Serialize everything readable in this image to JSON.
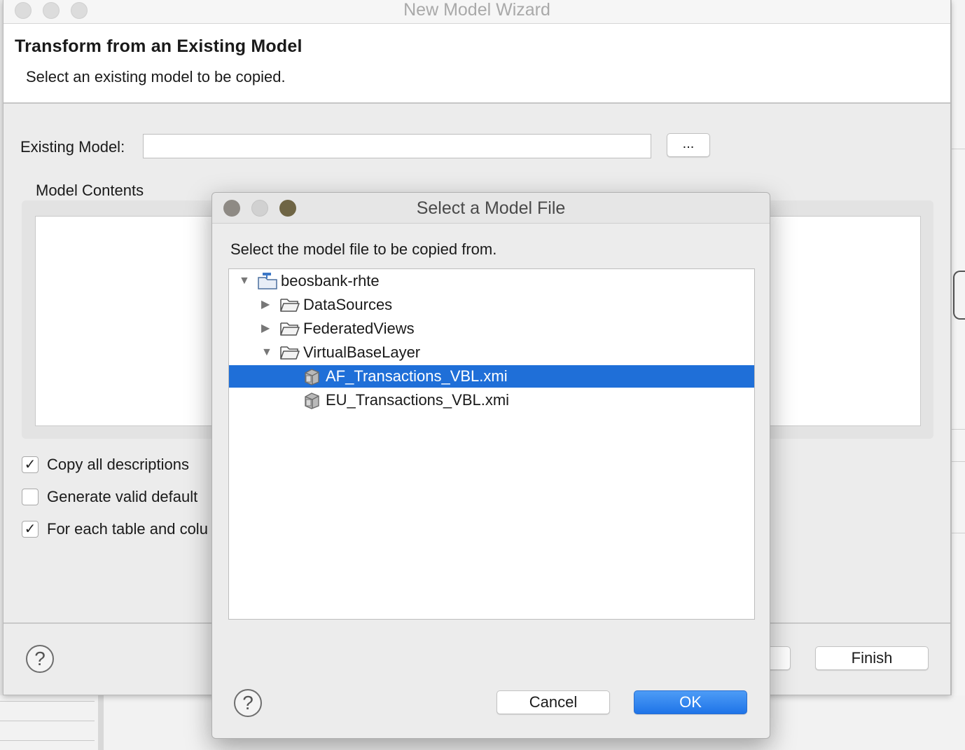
{
  "wizard": {
    "title": "New Model Wizard",
    "header_title": "Transform from an Existing Model",
    "header_description": "Select an existing model to be copied.",
    "existing_model_label": "Existing Model:",
    "existing_model_value": "",
    "browse_label": "...",
    "model_contents_label": "Model Contents",
    "options": [
      {
        "label": "Copy all descriptions",
        "checked": true
      },
      {
        "label": "Generate valid default",
        "checked": false
      },
      {
        "label": "For each table and colu",
        "checked": true
      }
    ],
    "finish_label": "Finish"
  },
  "dialog": {
    "title": "Select a Model File",
    "prompt": "Select the model file to be copied from.",
    "tree": [
      {
        "label": "beosbank-rhte",
        "kind": "project",
        "depth": 0,
        "expanded": true,
        "selected": false
      },
      {
        "label": "DataSources",
        "kind": "folder",
        "depth": 1,
        "expanded": false,
        "selected": false
      },
      {
        "label": "FederatedViews",
        "kind": "folder",
        "depth": 1,
        "expanded": false,
        "selected": false
      },
      {
        "label": "VirtualBaseLayer",
        "kind": "folder",
        "depth": 1,
        "expanded": true,
        "selected": false
      },
      {
        "label": "AF_Transactions_VBL.xmi",
        "kind": "model",
        "depth": 2,
        "expanded": null,
        "selected": true
      },
      {
        "label": "EU_Transactions_VBL.xmi",
        "kind": "model",
        "depth": 2,
        "expanded": null,
        "selected": false
      }
    ],
    "cancel_label": "Cancel",
    "ok_label": "OK"
  },
  "icons": {
    "help": "?",
    "checkmark": "✓",
    "expanded_arrow": "▼",
    "collapsed_arrow": "▶"
  },
  "colors": {
    "selection": "#1f6fd8",
    "primary_button": "#1f74e8",
    "dialog_traffic_light_close": "#8e8a84",
    "dialog_traffic_light_min": "#d1d1d1",
    "dialog_traffic_light_zoom": "#6f6545"
  }
}
